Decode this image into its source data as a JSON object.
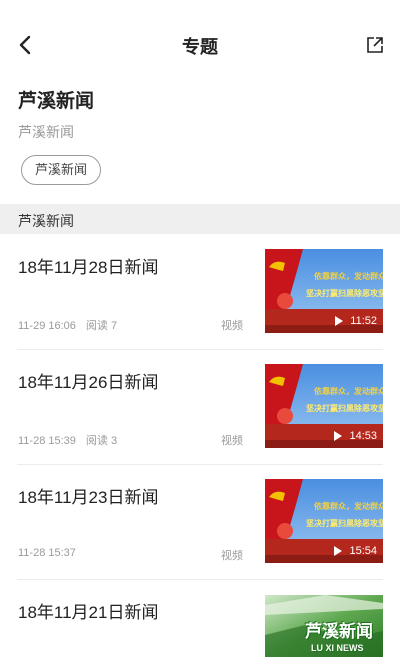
{
  "nav": {
    "title": "专题",
    "back_icon": "chevron-left-icon",
    "share_icon": "share-icon"
  },
  "topic": {
    "name": "芦溪新闻",
    "subtitle": "芦溪新闻",
    "tag": "芦溪新闻"
  },
  "section": {
    "label": "芦溪新闻"
  },
  "items": [
    {
      "title": "18年11月28日新闻",
      "time": "11-29 16:06",
      "reads": "阅读 7",
      "type": "视频",
      "duration": "11:52",
      "slogan_1": "依靠群众，发动群众，",
      "slogan_2": "坚决打赢扫黑除恶攻坚仗！"
    },
    {
      "title": "18年11月26日新闻",
      "time": "11-28 15:39",
      "reads": "阅读 3",
      "type": "视频",
      "duration": "14:53",
      "slogan_1": "依靠群众，发动群众，",
      "slogan_2": "坚决打赢扫黑除恶攻坚仗！"
    },
    {
      "title": "18年11月23日新闻",
      "time": "11-28 15:37",
      "reads": "",
      "type": "视频",
      "duration": "15:54",
      "slogan_1": "依靠群众，发动群众，",
      "slogan_2": "坚决打赢扫黑除恶攻坚仗！"
    },
    {
      "title": "18年11月21日新闻",
      "thumb_cn": "芦溪新闻",
      "thumb_en": "LU XI NEWS"
    }
  ],
  "colors": {
    "section_bg": "#efefef",
    "meta": "#9a9a9a",
    "banner_red": "#c8151b",
    "banner_sky": "#5b9be0"
  }
}
